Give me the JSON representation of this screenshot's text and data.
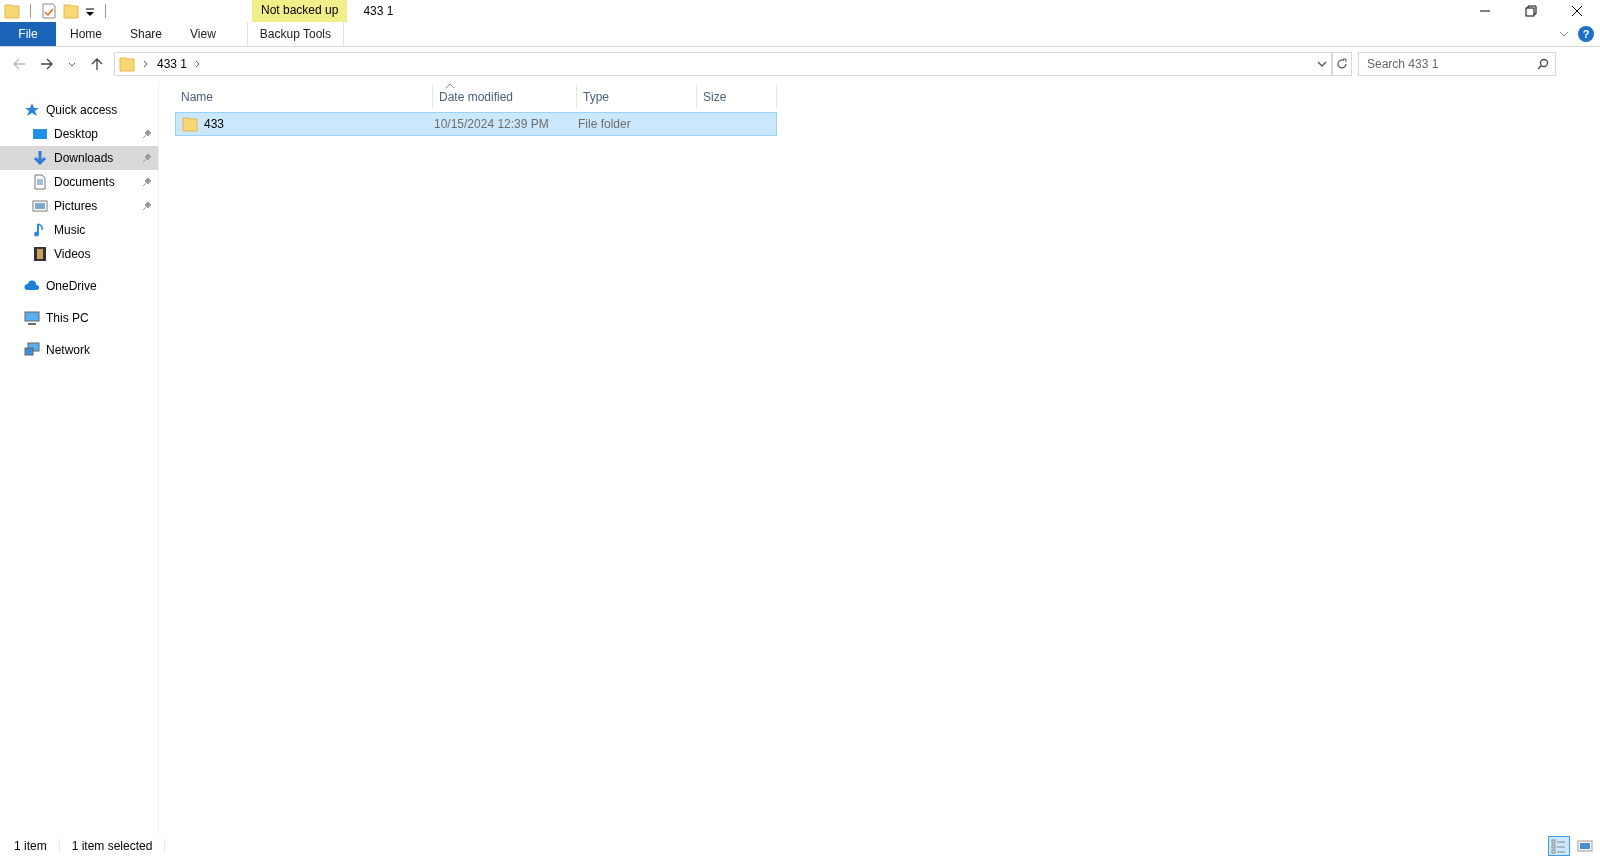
{
  "window": {
    "title": "433 1",
    "context_label": "Not backed up"
  },
  "ribbon_tabs": [
    {
      "label": "File",
      "kind": "file"
    },
    {
      "label": "Home",
      "kind": "normal"
    },
    {
      "label": "Share",
      "kind": "normal"
    },
    {
      "label": "View",
      "kind": "normal"
    },
    {
      "label": "Backup Tools",
      "kind": "contextual"
    }
  ],
  "help_button": "?",
  "address_bar": {
    "path": [
      "433 1"
    ]
  },
  "search": {
    "placeholder": "Search 433 1"
  },
  "sidebar": {
    "items": [
      {
        "label": "Quick access",
        "kind": "star",
        "selected": false,
        "children": [
          {
            "label": "Desktop",
            "kind": "desktop",
            "pinned": true,
            "selected": false
          },
          {
            "label": "Downloads",
            "kind": "download",
            "pinned": true,
            "selected": true
          },
          {
            "label": "Documents",
            "kind": "document",
            "pinned": true,
            "selected": false
          },
          {
            "label": "Pictures",
            "kind": "picture",
            "pinned": true,
            "selected": false
          },
          {
            "label": "Music",
            "kind": "music",
            "pinned": false,
            "selected": false
          },
          {
            "label": "Videos",
            "kind": "video",
            "pinned": false,
            "selected": false
          }
        ]
      },
      {
        "label": "OneDrive",
        "kind": "cloud",
        "selected": false
      },
      {
        "label": "This PC",
        "kind": "pc",
        "selected": false
      },
      {
        "label": "Network",
        "kind": "network",
        "selected": false
      }
    ]
  },
  "table": {
    "columns": [
      "Name",
      "Date modified",
      "Type",
      "Size"
    ],
    "rows": [
      {
        "cells": [
          "433",
          "10/15/2024 12:39 PM",
          "File folder",
          ""
        ],
        "selected": true
      }
    ]
  },
  "status_bar": {
    "items": [
      "1 item",
      "1 item selected"
    ],
    "views": [
      {
        "kind": "details",
        "selected": true
      },
      {
        "kind": "large_icons",
        "selected": false
      }
    ]
  }
}
